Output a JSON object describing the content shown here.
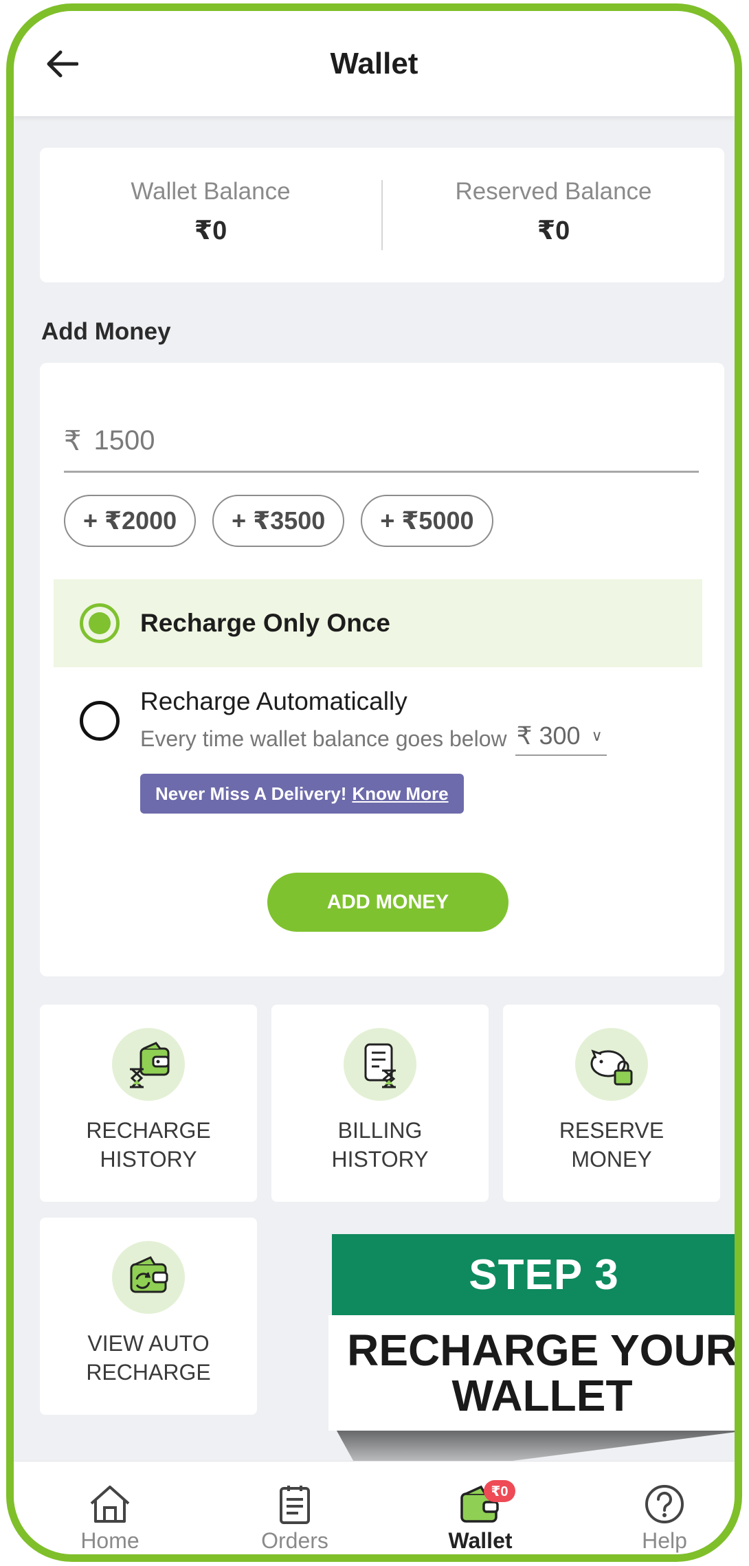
{
  "header": {
    "title": "Wallet"
  },
  "balances": {
    "wallet_label": "Wallet Balance",
    "wallet_value": "₹0",
    "reserved_label": "Reserved Balance",
    "reserved_value": "₹0"
  },
  "add_money": {
    "section_title": "Add Money",
    "currency_symbol": "₹",
    "amount_value": "1500",
    "quick_amounts": [
      "+ ₹2000",
      "+ ₹3500",
      "+ ₹5000"
    ],
    "option_once": {
      "label": "Recharge Only Once",
      "selected": true
    },
    "option_auto": {
      "label": "Recharge Automatically",
      "subtitle": "Every time wallet balance goes below",
      "threshold": "₹ 300",
      "selected": false
    },
    "promo": {
      "text": "Never Miss A Delivery!",
      "link": "Know More"
    },
    "button_label": "ADD MONEY"
  },
  "tiles": [
    {
      "label": "RECHARGE HISTORY",
      "icon": "wallet-hourglass-icon"
    },
    {
      "label": "BILLING HISTORY",
      "icon": "bill-hourglass-icon"
    },
    {
      "label": "RESERVE MONEY",
      "icon": "piggy-bank-lock-icon"
    },
    {
      "label": "VIEW AUTO RECHARGE",
      "icon": "wallet-refresh-icon"
    }
  ],
  "banner": {
    "step": "STEP 3",
    "text": "RECHARGE YOUR WALLET"
  },
  "bottom_nav": {
    "items": [
      {
        "label": "Home",
        "icon": "home-icon",
        "active": false
      },
      {
        "label": "Orders",
        "icon": "clipboard-icon",
        "active": false
      },
      {
        "label": "Wallet",
        "icon": "wallet-icon",
        "active": true,
        "badge": "₹0"
      },
      {
        "label": "Help",
        "icon": "help-icon",
        "active": false
      }
    ]
  },
  "colors": {
    "accent": "#7fc22f",
    "banner": "#0e8a5e",
    "promo": "#6d6bab",
    "badge": "#ee4b56"
  }
}
